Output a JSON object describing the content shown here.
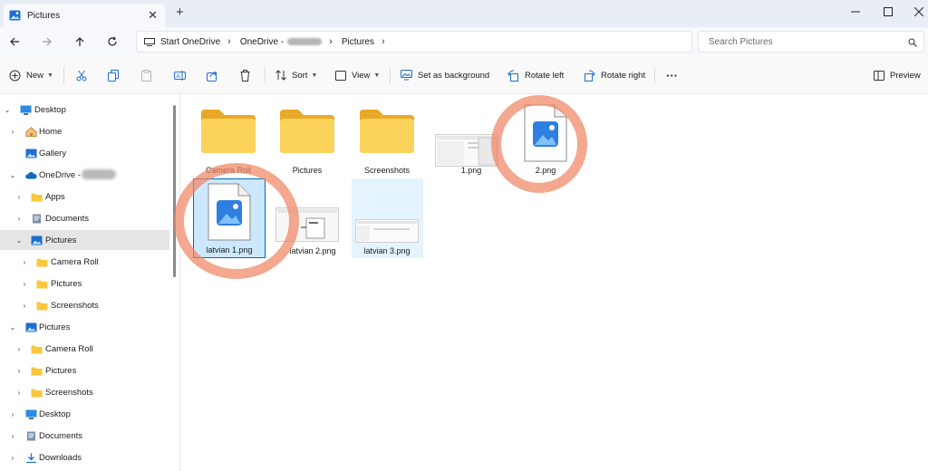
{
  "window": {
    "tab_title": "Pictures",
    "tab_icon": "pictures-folder-icon",
    "new_tab": "+",
    "controls": [
      "minimize-icon",
      "maximize-icon",
      "close-icon"
    ]
  },
  "address": {
    "crumbs": [
      "Start OneDrive",
      "OneDrive -",
      "Pictures"
    ],
    "search_placeholder": "Search Pictures"
  },
  "toolbar": {
    "new_label": "New",
    "sort_label": "Sort",
    "view_label": "View",
    "set_background_label": "Set as background",
    "rotate_left_label": "Rotate left",
    "rotate_right_label": "Rotate right",
    "more_label": "···",
    "preview_label": "Preview"
  },
  "sidebar": {
    "items": [
      {
        "label": "Desktop",
        "icon": "desktop-icon"
      },
      {
        "label": "Home",
        "icon": "home-icon"
      },
      {
        "label": "Gallery",
        "icon": "gallery-icon"
      },
      {
        "label": "OneDrive -",
        "icon": "onedrive-cloud-icon"
      },
      {
        "label": "Apps",
        "icon": "folder-icon"
      },
      {
        "label": "Documents",
        "icon": "documents-icon"
      },
      {
        "label": "Pictures",
        "icon": "pictures-icon",
        "selected": true
      },
      {
        "label": "Camera Roll",
        "icon": "folder-icon"
      },
      {
        "label": "Pictures",
        "icon": "folder-icon"
      },
      {
        "label": "Screenshots",
        "icon": "folder-icon"
      },
      {
        "label": "Pictures",
        "icon": "pictures-icon"
      },
      {
        "label": "Camera Roll",
        "icon": "folder-icon"
      },
      {
        "label": "Pictures",
        "icon": "folder-icon"
      },
      {
        "label": "Screenshots",
        "icon": "folder-icon"
      },
      {
        "label": "Desktop",
        "icon": "desktop-icon"
      },
      {
        "label": "Documents",
        "icon": "documents-icon"
      },
      {
        "label": "Downloads",
        "icon": "download-icon"
      }
    ]
  },
  "files": [
    {
      "name": "Camera Roll",
      "type": "folder"
    },
    {
      "name": "Pictures",
      "type": "folder"
    },
    {
      "name": "Screenshots",
      "type": "folder"
    },
    {
      "name": "1.png",
      "type": "thumbnail"
    },
    {
      "name": "2.png",
      "type": "image-icon",
      "annotated": true
    },
    {
      "name": "latvian 1.png",
      "type": "image-icon",
      "selected": true,
      "annotated": true
    },
    {
      "name": "latvian 2.png",
      "type": "thumbnail"
    },
    {
      "name": "latvian 3.png",
      "type": "thumbnail",
      "hovered": true
    }
  ],
  "colors": {
    "accent": "#0067c0",
    "folder": "#f8c73c",
    "annotation": "#ee8664",
    "selection": "#cce8ff"
  }
}
